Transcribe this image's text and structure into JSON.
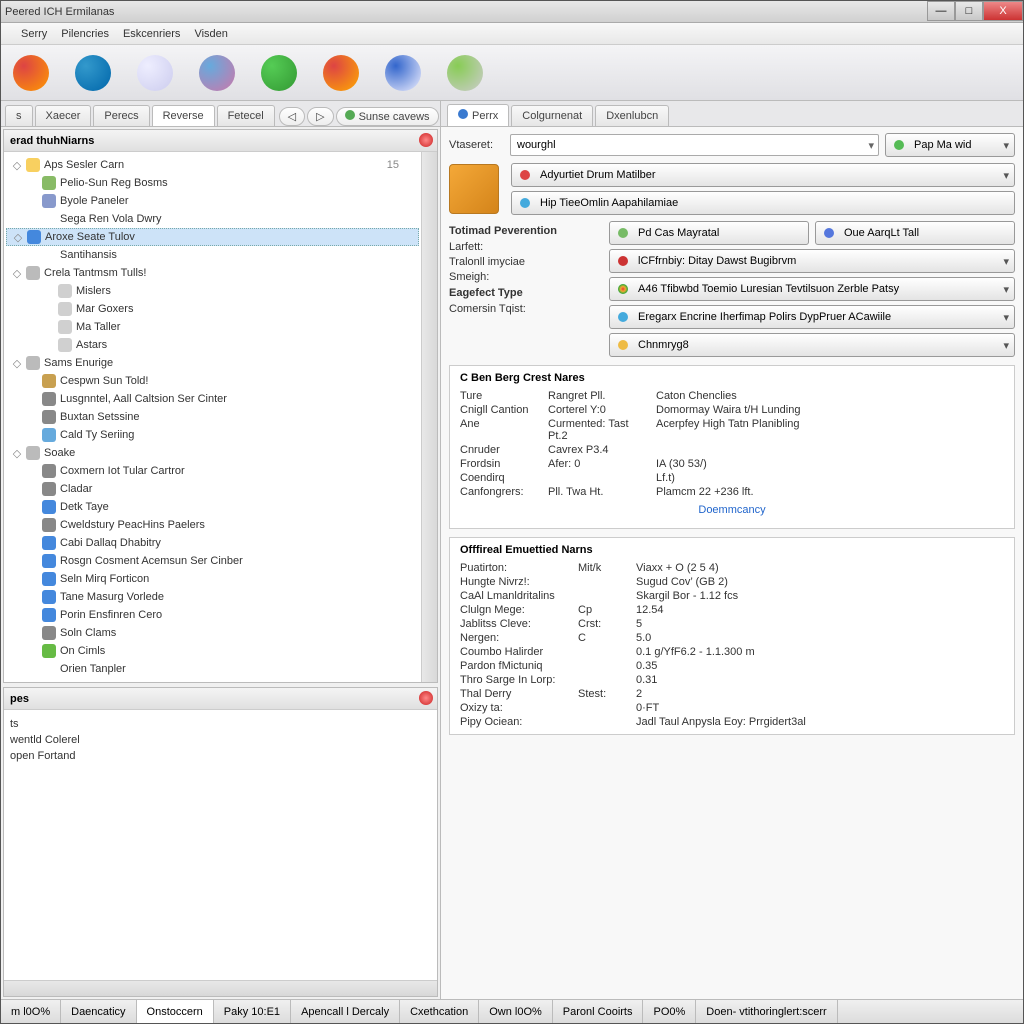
{
  "window": {
    "title": "Peered ICH Ermilanas"
  },
  "menu": [
    "",
    "Serry",
    "Pilencries",
    "Eskcenriers",
    "Visden"
  ],
  "toolbar_icons": [
    {
      "name": "globe-red",
      "color1": "#d44",
      "color2": "#f90"
    },
    {
      "name": "globe-blue",
      "color1": "#39c",
      "color2": "#06a"
    },
    {
      "name": "doc",
      "color1": "#eef",
      "color2": "#cce"
    },
    {
      "name": "globe-multi",
      "color1": "#6ad",
      "color2": "#c7a"
    },
    {
      "name": "person-green",
      "color1": "#5c5",
      "color2": "#393"
    },
    {
      "name": "swap",
      "color1": "#d44",
      "color2": "#fa0"
    },
    {
      "name": "clipboard",
      "color1": "#36c",
      "color2": "#eef"
    },
    {
      "name": "wrench",
      "color1": "#8c5",
      "color2": "#ccc"
    }
  ],
  "left_tabs": [
    "s",
    "Xaecer",
    "Perecs",
    "Reverse",
    "Fetecel"
  ],
  "left_tab_extra": "Sunse cavews",
  "tree_panel_title": "erad thuhNiarns",
  "tree": [
    {
      "exp": "◇",
      "icon": "#f8d060",
      "label": "Aps Sesler Carn",
      "indent": 0,
      "note": "15"
    },
    {
      "exp": "",
      "icon": "#88bb66",
      "label": "Pelio-Sun Reg Bosms",
      "indent": 1
    },
    {
      "exp": "",
      "icon": "#8899cc",
      "label": "Byole Paneler",
      "indent": 1
    },
    {
      "exp": "",
      "icon": "",
      "label": "Sega Ren Vola Dwry",
      "indent": 1
    },
    {
      "exp": "◇",
      "icon": "#4488dd",
      "label": "Aroxe Seate Tulov",
      "indent": 0,
      "sel": true
    },
    {
      "exp": "",
      "icon": "",
      "label": "Santihansis",
      "indent": 1
    },
    {
      "exp": "◇",
      "icon": "#bbbbbb",
      "label": "Crela Tantmsm Tulls!",
      "indent": 0
    },
    {
      "exp": "",
      "icon": "#d0d0d0",
      "label": "Mislers",
      "indent": 2
    },
    {
      "exp": "",
      "icon": "#d0d0d0",
      "label": "Mar Goxers",
      "indent": 2
    },
    {
      "exp": "",
      "icon": "#d0d0d0",
      "label": "Ma Taller",
      "indent": 2
    },
    {
      "exp": "",
      "icon": "#d0d0d0",
      "label": "Astars",
      "indent": 2
    },
    {
      "exp": "◇",
      "icon": "#bbbbbb",
      "label": "Sams Enurige",
      "indent": 0
    },
    {
      "exp": "",
      "icon": "#c8a050",
      "label": "Cespwn Sun Told!",
      "indent": 1
    },
    {
      "exp": "",
      "icon": "#888888",
      "label": "Lusgnntel, Aall Caltsion Ser Cinter",
      "indent": 1
    },
    {
      "exp": "",
      "icon": "#888888",
      "label": "Buxtan Setssine",
      "indent": 1
    },
    {
      "exp": "",
      "icon": "#66aadd",
      "label": "Cald Ty Seriing",
      "indent": 1
    },
    {
      "exp": "◇",
      "icon": "#bbbbbb",
      "label": "Soake",
      "indent": 0
    },
    {
      "exp": "",
      "icon": "#888888",
      "label": "Coxmern Iot Tular Cartror",
      "indent": 1
    },
    {
      "exp": "",
      "icon": "#888888",
      "label": "Cladar",
      "indent": 1
    },
    {
      "exp": "",
      "icon": "#4488dd",
      "label": "Detk Taye",
      "indent": 1
    },
    {
      "exp": "",
      "icon": "#888888",
      "label": "Cweldstury PeacHins Paelers",
      "indent": 1
    },
    {
      "exp": "",
      "icon": "#4488dd",
      "label": "Cabi Dallaq Dhabitry",
      "indent": 1
    },
    {
      "exp": "",
      "icon": "#4488dd",
      "label": "Rosgn Cosment Acemsun Ser Cinber",
      "indent": 1
    },
    {
      "exp": "",
      "icon": "#4488dd",
      "label": "Seln Mirq Forticon",
      "indent": 1
    },
    {
      "exp": "",
      "icon": "#4488dd",
      "label": "Tane Masurg Vorlede",
      "indent": 1
    },
    {
      "exp": "",
      "icon": "#4488dd",
      "label": "Porin Ensfinren Cero",
      "indent": 1
    },
    {
      "exp": "",
      "icon": "#888888",
      "label": "Soln Clams",
      "indent": 1
    },
    {
      "exp": "",
      "icon": "#66bb44",
      "label": "On Cimls",
      "indent": 1
    },
    {
      "exp": "",
      "icon": "",
      "label": "Orien Tanpler",
      "indent": 1
    }
  ],
  "bottom_panel_title": "pes",
  "bottom_items": [
    "ts",
    "wentld Colerel",
    "open Fortand"
  ],
  "right_tabs": [
    {
      "label": "Perrx",
      "icon": "#3a7ad0"
    },
    {
      "label": "Colgurnenat",
      "icon": ""
    },
    {
      "label": "Dxenlubcn",
      "icon": ""
    }
  ],
  "form": {
    "viewer_label": "Vtaseret:",
    "viewer_value": "wourghl",
    "viewer_btn": "Pap Ma wid",
    "action1": "Adyurtiet Drum Matilber",
    "action2": "Hip TieeOmlin Aapahilamiae",
    "section1": "Totimad Peverention",
    "btn_pd": "Pd Cas Mayratal",
    "btn_our": "Oue AarqLt Tall",
    "lbl_lufert": "Larfett:",
    "lbl_tral": "Tralonll imyciae",
    "lbl_smergh": "Smeigh:",
    "lbl_eypfet": "Eagefect Type",
    "lbl_comser": "Comersin Tqist:",
    "combo1": "lCFfrnbiy: Ditay Dawst Bugibrvm",
    "combo2": "A46 Tfibwbd Toemio Luresian Tevtilsuon Zerble Patsy",
    "combo3": "Eregarx Encrine Iherfimap Polirs DypPruer ACawiile",
    "combo4": "Chnmryg8"
  },
  "props1": {
    "title": "C Ben Berg Crest Nares",
    "rows": [
      [
        "Ture",
        "Rangret Pll.",
        "Caton Chenclies"
      ],
      [
        "Cnigll Cantion",
        "Corterel Y:0",
        "Domormay Waira t/H Lunding"
      ],
      [
        "Ane",
        "Curmented: Tast Pt.2",
        "Acerpfey High Tatn Planibling"
      ],
      [
        "Cnruder",
        "Cavrex P3.4",
        ""
      ],
      [
        "Frordsin",
        "Afer: 0",
        "IA (30 53/)"
      ],
      [
        "Coendirq",
        "",
        "Lf.t)"
      ],
      [
        "Canfongrers:",
        "Pll.      Twa Ht.",
        "Plamcm 22 +236 lft."
      ]
    ],
    "link": "Doemmcancy"
  },
  "props2": {
    "title": "Offfireal Emuettied Narns",
    "rows": [
      [
        "Puatirton:",
        "Mit/k",
        "Viaxx + O (2 5 4)"
      ],
      [
        "Hungte Nivrz!:",
        "",
        "Sugud Cov’ (GB 2)"
      ],
      [
        "CaAl Lmanldritalins",
        "",
        "Skargil Bor - 1.12 fcs"
      ],
      [
        "Clulgn Mege:",
        "Cp",
        "12.54"
      ],
      [
        "Jablitss Cleve:",
        "Crst:",
        "5"
      ],
      [
        "Nergen:",
        "C",
        "5.0"
      ],
      [
        "Coumbo Halirder",
        "",
        "0.1 g/YfF6.2 - 1.1.300 m"
      ],
      [
        "Pardon fMictuniq",
        "",
        "0.35"
      ],
      [
        "Thro Sarge In Lorp:",
        "",
        "0.31"
      ],
      [
        "Thal Derry",
        "Stest:",
        "2"
      ],
      [
        "Oxizy ta:",
        "",
        "0·FT"
      ],
      [
        "Pipy Ociean:",
        "",
        "Jadl Taul Anpysla Eoy: Prrgidert3al"
      ]
    ]
  },
  "status": [
    "m l0O%",
    "Daencaticy",
    "Onstoccern",
    "Paky 10:E1",
    "Apencall l Dercaly",
    "Cxethcation",
    "Own l0O%",
    "Paronl Cooirts",
    "PO0%",
    "Doen- vtithoringlert:scerr"
  ]
}
